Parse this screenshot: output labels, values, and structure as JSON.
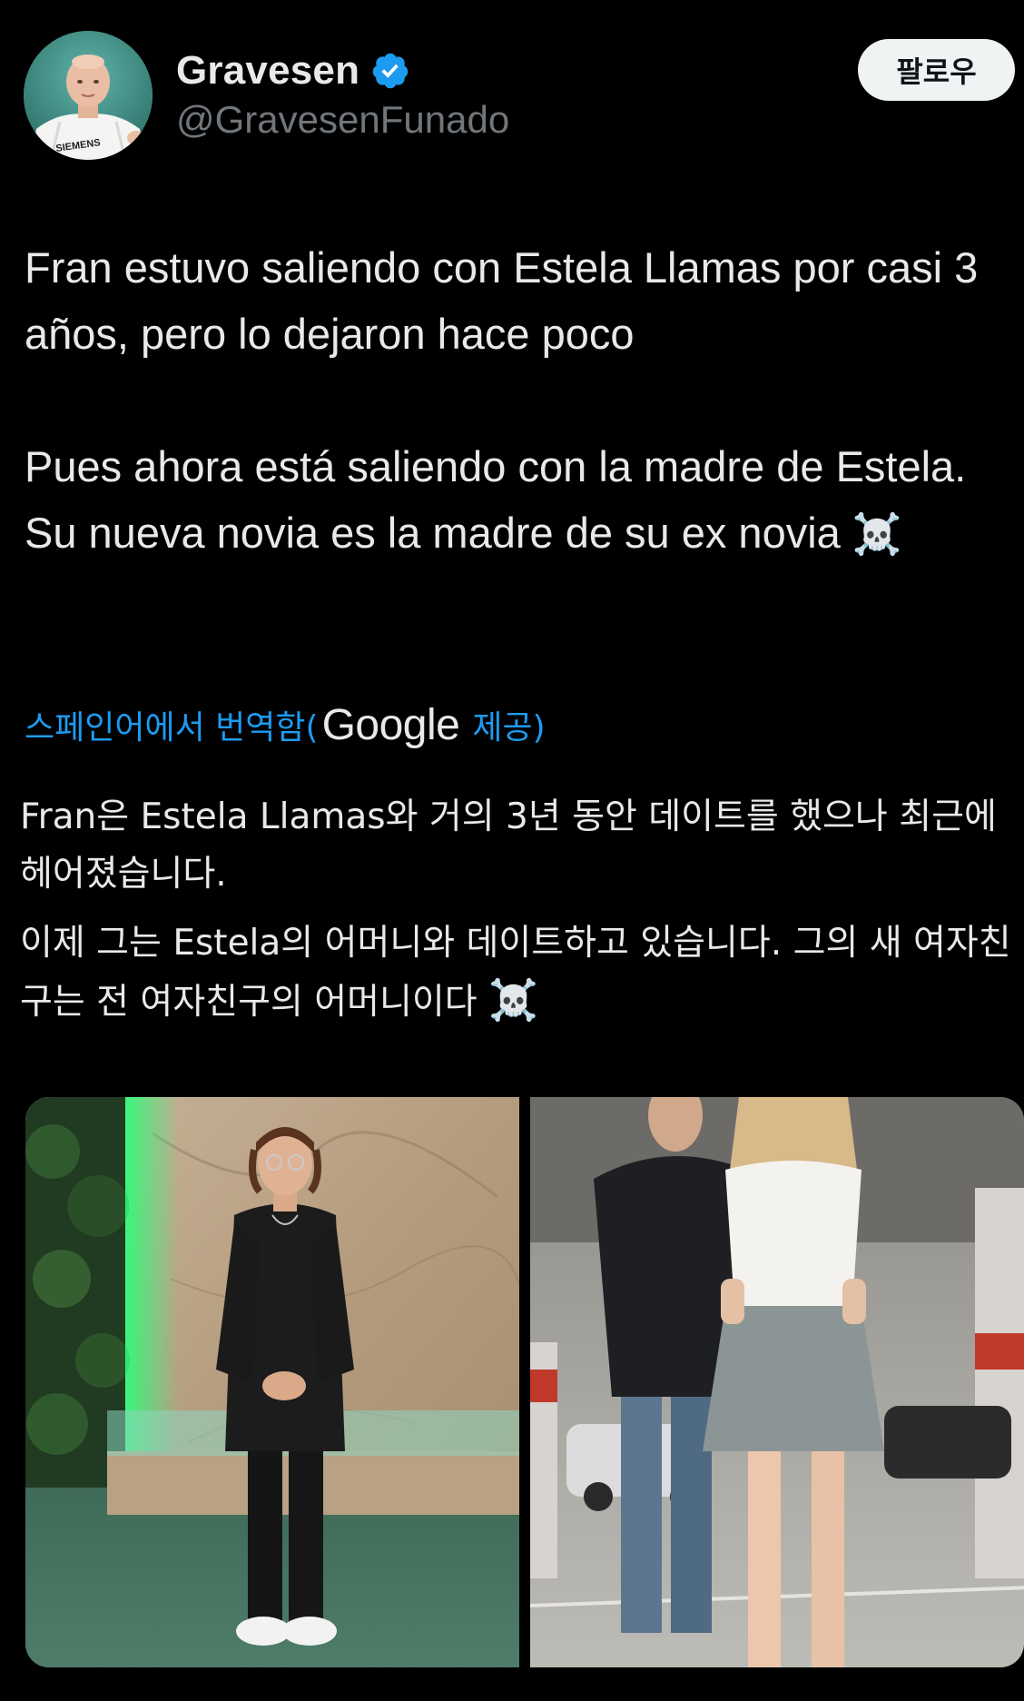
{
  "author": {
    "display_name": "Gravesen",
    "handle": "@GravesenFunado",
    "verified": true,
    "avatar_text": "SIEMENS"
  },
  "follow_button_label": "팔로우",
  "tweet": {
    "paragraph_1": "Fran estuvo saliendo con Estela Llamas por casi 3 años, pero lo dejaron hace poco",
    "paragraph_2": "Pues ahora está saliendo con la madre de Estela. Su nueva novia es la madre de su ex novia",
    "emoji": "☠️"
  },
  "translation": {
    "label_prefix": "스페인어에서 번역함(",
    "provider": "Google",
    "label_suffix": "제공)",
    "paragraph_1": "Fran은 Estela Llamas와 거의 3년 동안 데이트를 했으나 최근에 헤어졌습니다.",
    "paragraph_2": "이제 그는 Estela의 어머니와 데이트하고 있습니다. 그의 새 여자친구는 전 여자친구의 어머니이다",
    "emoji": "☠️"
  },
  "media": [
    {
      "name": "photo-man-standing"
    },
    {
      "name": "photo-parking-garage"
    }
  ],
  "colors": {
    "background": "#000000",
    "text": "#e7e9ea",
    "secondary_text": "#71767b",
    "link": "#1d9bf0",
    "verified_badge": "#1d9bf0",
    "follow_button_bg": "#eff3f4",
    "follow_button_text": "#0f1419"
  },
  "icons": {
    "verified": "verified-badge-icon",
    "skull": "skull-crossbones-emoji"
  }
}
